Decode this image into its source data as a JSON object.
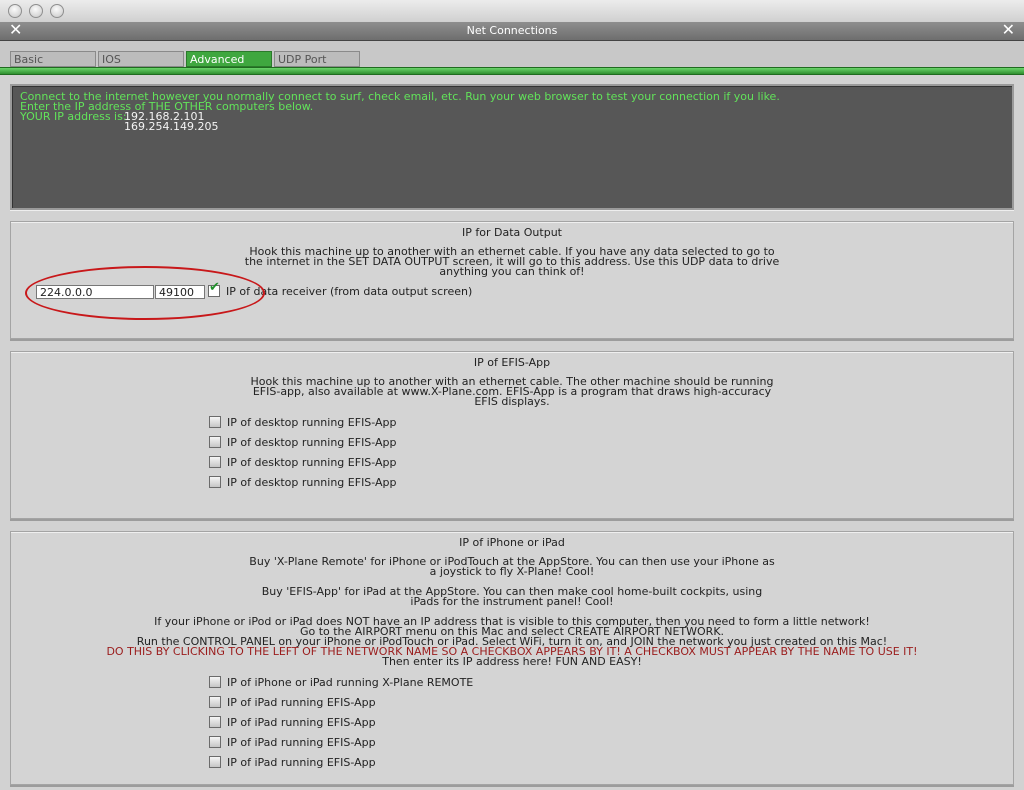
{
  "window": {
    "title": "Net Connections"
  },
  "tabs": [
    {
      "label": "Basic"
    },
    {
      "label": "IOS"
    },
    {
      "label": "Advanced"
    },
    {
      "label": "UDP Port"
    }
  ],
  "info": {
    "line1": "Connect to the internet however you normally connect to surf, check email, etc. Run your web browser to test your connection if you like.",
    "line2": "Enter the IP address of THE OTHER computers below.",
    "ip_label": "YOUR IP address is:",
    "ip1": "192.168.2.101",
    "ip2": "169.254.149.205"
  },
  "data_output": {
    "title": "IP for Data Output",
    "desc": [
      "Hook this machine up to another with an ethernet cable. If you have any data selected to go to",
      "the internet in the SET DATA OUTPUT screen, it will go to this address. Use this UDP data to drive",
      "anything you can think of!"
    ],
    "ip_value": "224.0.0.0",
    "port_value": "49100",
    "checkbox_label": "IP of data receiver (from data output screen)"
  },
  "efis": {
    "title": "IP of EFIS-App",
    "desc": [
      "Hook this machine up to another with an ethernet cable. The other machine should be running",
      "EFIS-app, also available at www.X-Plane.com. EFIS-App is a program that draws high-accuracy",
      "EFIS displays."
    ],
    "items": [
      {
        "label": "IP of desktop running EFIS-App"
      },
      {
        "label": "IP of desktop running EFIS-App"
      },
      {
        "label": "IP of desktop running EFIS-App"
      },
      {
        "label": "IP of desktop running EFIS-App"
      }
    ]
  },
  "iphone": {
    "title": "IP of iPhone or iPad",
    "para1": [
      "Buy 'X-Plane Remote' for iPhone or iPodTouch at the AppStore. You can then use your iPhone as",
      "a joystick to fly X-Plane!  Cool!"
    ],
    "para2": [
      "Buy 'EFIS-App' for iPad at the AppStore. You can then make cool home-built cockpits, using",
      "iPads for the instrument panel! Cool!"
    ],
    "para3": [
      "If your iPhone or iPod or iPad does NOT have an IP address that is visible to this computer, then you need to form a little network!",
      "Go to the AIRPORT menu on this Mac and select CREATE AIRPORT NETWORK.",
      "Run the CONTROL PANEL on your iPhone or iPodTouch or iPad. Select WiFi, turn it on, and JOIN the network you just created on this Mac!"
    ],
    "warning": "DO THIS BY CLICKING TO THE LEFT OF THE NETWORK NAME SO A CHECKBOX APPEARS BY IT! A CHECKBOX MUST APPEAR BY THE NAME TO USE IT!",
    "final": "Then enter its IP address here! FUN AND EASY!",
    "items": [
      {
        "label": "IP of iPhone or iPad running X-Plane REMOTE"
      },
      {
        "label": "IP of iPad running EFIS-App"
      },
      {
        "label": "IP of iPad running EFIS-App"
      },
      {
        "label": "IP of iPad running EFIS-App"
      },
      {
        "label": "IP of iPad running EFIS-App"
      }
    ]
  },
  "colors": {
    "accent_green": "#3fa73f",
    "info_text_green": "#62e35a",
    "warning_red": "#9a1c1c",
    "highlight_ellipse": "#c8181a"
  }
}
